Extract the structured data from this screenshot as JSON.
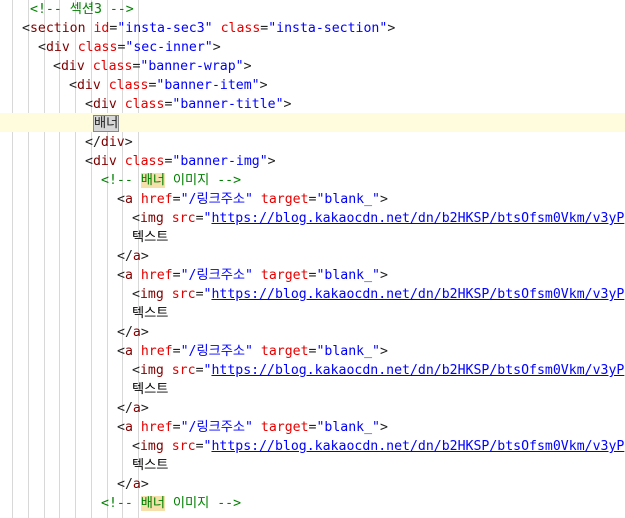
{
  "lines": [
    {
      "indent": 3,
      "parts": [
        {
          "t": "<!-- 섹션3 -->",
          "c": "comment"
        }
      ]
    },
    {
      "indent": 2,
      "parts": [
        {
          "t": "<",
          "c": "punct"
        },
        {
          "t": "section",
          "c": "tag"
        },
        {
          "t": " ",
          "c": "punct"
        },
        {
          "t": "id",
          "c": "attr"
        },
        {
          "t": "=",
          "c": "punct"
        },
        {
          "t": "\"insta-sec3\"",
          "c": "val"
        },
        {
          "t": " ",
          "c": "punct"
        },
        {
          "t": "class",
          "c": "attr"
        },
        {
          "t": "=",
          "c": "punct"
        },
        {
          "t": "\"insta-section\"",
          "c": "val"
        },
        {
          "t": ">",
          "c": "punct"
        }
      ]
    },
    {
      "indent": 4,
      "parts": [
        {
          "t": "<",
          "c": "punct"
        },
        {
          "t": "div",
          "c": "tag"
        },
        {
          "t": " ",
          "c": "punct"
        },
        {
          "t": "class",
          "c": "attr"
        },
        {
          "t": "=",
          "c": "punct"
        },
        {
          "t": "\"sec-inner\"",
          "c": "val"
        },
        {
          "t": ">",
          "c": "punct"
        }
      ]
    },
    {
      "indent": 6,
      "parts": [
        {
          "t": "<",
          "c": "punct"
        },
        {
          "t": "div",
          "c": "tag"
        },
        {
          "t": " ",
          "c": "punct"
        },
        {
          "t": "class",
          "c": "attr"
        },
        {
          "t": "=",
          "c": "punct"
        },
        {
          "t": "\"banner-wrap\"",
          "c": "val"
        },
        {
          "t": ">",
          "c": "punct"
        }
      ]
    },
    {
      "indent": 8,
      "parts": [
        {
          "t": "<",
          "c": "punct"
        },
        {
          "t": "div",
          "c": "tag"
        },
        {
          "t": " ",
          "c": "punct"
        },
        {
          "t": "class",
          "c": "attr"
        },
        {
          "t": "=",
          "c": "punct"
        },
        {
          "t": "\"banner-item\"",
          "c": "val"
        },
        {
          "t": ">",
          "c": "punct"
        }
      ]
    },
    {
      "indent": 10,
      "parts": [
        {
          "t": "<",
          "c": "punct"
        },
        {
          "t": "div",
          "c": "tag"
        },
        {
          "t": " ",
          "c": "punct"
        },
        {
          "t": "class",
          "c": "attr"
        },
        {
          "t": "=",
          "c": "punct"
        },
        {
          "t": "\"banner-title\"",
          "c": "val"
        },
        {
          "t": ">",
          "c": "punct"
        }
      ]
    },
    {
      "indent": 11,
      "parts": [
        {
          "t": "배너",
          "c": "sel"
        }
      ]
    },
    {
      "indent": 10,
      "parts": [
        {
          "t": "</",
          "c": "punct"
        },
        {
          "t": "div",
          "c": "tag"
        },
        {
          "t": ">",
          "c": "punct"
        }
      ]
    },
    {
      "indent": 10,
      "parts": [
        {
          "t": "<",
          "c": "punct"
        },
        {
          "t": "div",
          "c": "tag"
        },
        {
          "t": " ",
          "c": "punct"
        },
        {
          "t": "class",
          "c": "attr"
        },
        {
          "t": "=",
          "c": "punct"
        },
        {
          "t": "\"banner-img\"",
          "c": "val"
        },
        {
          "t": ">",
          "c": "punct"
        }
      ]
    },
    {
      "indent": 12,
      "parts": [
        {
          "t": "<!-- ",
          "c": "comment"
        },
        {
          "t": "배너",
          "c": "comment hl"
        },
        {
          "t": " 이미지 -->",
          "c": "comment"
        }
      ]
    },
    {
      "indent": 14,
      "parts": [
        {
          "t": "<",
          "c": "punct"
        },
        {
          "t": "a",
          "c": "tag"
        },
        {
          "t": " ",
          "c": "punct"
        },
        {
          "t": "href",
          "c": "attr"
        },
        {
          "t": "=",
          "c": "punct"
        },
        {
          "t": "\"/링크주소\"",
          "c": "val"
        },
        {
          "t": " ",
          "c": "punct"
        },
        {
          "t": "target",
          "c": "attr"
        },
        {
          "t": "=",
          "c": "punct"
        },
        {
          "t": "\"blank_\"",
          "c": "val"
        },
        {
          "t": ">",
          "c": "punct"
        }
      ]
    },
    {
      "indent": 16,
      "parts": [
        {
          "t": "<",
          "c": "punct"
        },
        {
          "t": "img",
          "c": "tag"
        },
        {
          "t": " ",
          "c": "punct"
        },
        {
          "t": "src",
          "c": "attr"
        },
        {
          "t": "=",
          "c": "punct"
        },
        {
          "t": "\"",
          "c": "val"
        },
        {
          "t": "https://blog.kakaocdn.net/dn/b2HKSP/btsOfsm0Vkm/v3yP",
          "c": "url"
        }
      ]
    },
    {
      "indent": 16,
      "parts": [
        {
          "t": "텍스트",
          "c": "txt"
        }
      ]
    },
    {
      "indent": 14,
      "parts": [
        {
          "t": "</",
          "c": "punct"
        },
        {
          "t": "a",
          "c": "tag"
        },
        {
          "t": ">",
          "c": "punct"
        }
      ]
    },
    {
      "indent": 14,
      "parts": [
        {
          "t": "<",
          "c": "punct"
        },
        {
          "t": "a",
          "c": "tag"
        },
        {
          "t": " ",
          "c": "punct"
        },
        {
          "t": "href",
          "c": "attr"
        },
        {
          "t": "=",
          "c": "punct"
        },
        {
          "t": "\"/링크주소\"",
          "c": "val"
        },
        {
          "t": " ",
          "c": "punct"
        },
        {
          "t": "target",
          "c": "attr"
        },
        {
          "t": "=",
          "c": "punct"
        },
        {
          "t": "\"blank_\"",
          "c": "val"
        },
        {
          "t": ">",
          "c": "punct"
        }
      ]
    },
    {
      "indent": 16,
      "parts": [
        {
          "t": "<",
          "c": "punct"
        },
        {
          "t": "img",
          "c": "tag"
        },
        {
          "t": " ",
          "c": "punct"
        },
        {
          "t": "src",
          "c": "attr"
        },
        {
          "t": "=",
          "c": "punct"
        },
        {
          "t": "\"",
          "c": "val"
        },
        {
          "t": "https://blog.kakaocdn.net/dn/b2HKSP/btsOfsm0Vkm/v3yP",
          "c": "url"
        }
      ]
    },
    {
      "indent": 16,
      "parts": [
        {
          "t": "텍스트",
          "c": "txt"
        }
      ]
    },
    {
      "indent": 14,
      "parts": [
        {
          "t": "</",
          "c": "punct"
        },
        {
          "t": "a",
          "c": "tag"
        },
        {
          "t": ">",
          "c": "punct"
        }
      ]
    },
    {
      "indent": 14,
      "parts": [
        {
          "t": "<",
          "c": "punct"
        },
        {
          "t": "a",
          "c": "tag"
        },
        {
          "t": " ",
          "c": "punct"
        },
        {
          "t": "href",
          "c": "attr"
        },
        {
          "t": "=",
          "c": "punct"
        },
        {
          "t": "\"/링크주소\"",
          "c": "val"
        },
        {
          "t": " ",
          "c": "punct"
        },
        {
          "t": "target",
          "c": "attr"
        },
        {
          "t": "=",
          "c": "punct"
        },
        {
          "t": "\"blank_\"",
          "c": "val"
        },
        {
          "t": ">",
          "c": "punct"
        }
      ]
    },
    {
      "indent": 16,
      "parts": [
        {
          "t": "<",
          "c": "punct"
        },
        {
          "t": "img",
          "c": "tag"
        },
        {
          "t": " ",
          "c": "punct"
        },
        {
          "t": "src",
          "c": "attr"
        },
        {
          "t": "=",
          "c": "punct"
        },
        {
          "t": "\"",
          "c": "val"
        },
        {
          "t": "https://blog.kakaocdn.net/dn/b2HKSP/btsOfsm0Vkm/v3yP",
          "c": "url"
        }
      ]
    },
    {
      "indent": 16,
      "parts": [
        {
          "t": "텍스트",
          "c": "txt"
        }
      ]
    },
    {
      "indent": 14,
      "parts": [
        {
          "t": "</",
          "c": "punct"
        },
        {
          "t": "a",
          "c": "tag"
        },
        {
          "t": ">",
          "c": "punct"
        }
      ]
    },
    {
      "indent": 14,
      "parts": [
        {
          "t": "<",
          "c": "punct"
        },
        {
          "t": "a",
          "c": "tag"
        },
        {
          "t": " ",
          "c": "punct"
        },
        {
          "t": "href",
          "c": "attr"
        },
        {
          "t": "=",
          "c": "punct"
        },
        {
          "t": "\"/링크주소\"",
          "c": "val"
        },
        {
          "t": " ",
          "c": "punct"
        },
        {
          "t": "target",
          "c": "attr"
        },
        {
          "t": "=",
          "c": "punct"
        },
        {
          "t": "\"blank_\"",
          "c": "val"
        },
        {
          "t": ">",
          "c": "punct"
        }
      ]
    },
    {
      "indent": 16,
      "parts": [
        {
          "t": "<",
          "c": "punct"
        },
        {
          "t": "img",
          "c": "tag"
        },
        {
          "t": " ",
          "c": "punct"
        },
        {
          "t": "src",
          "c": "attr"
        },
        {
          "t": "=",
          "c": "punct"
        },
        {
          "t": "\"",
          "c": "val"
        },
        {
          "t": "https://blog.kakaocdn.net/dn/b2HKSP/btsOfsm0Vkm/v3yP",
          "c": "url"
        }
      ]
    },
    {
      "indent": 16,
      "parts": [
        {
          "t": "텍스트",
          "c": "txt"
        }
      ]
    },
    {
      "indent": 14,
      "parts": [
        {
          "t": "</",
          "c": "punct"
        },
        {
          "t": "a",
          "c": "tag"
        },
        {
          "t": ">",
          "c": "punct"
        }
      ]
    },
    {
      "indent": 12,
      "parts": [
        {
          "t": "<!-- ",
          "c": "comment"
        },
        {
          "t": "배너",
          "c": "comment hl"
        },
        {
          "t": " 이미지 -->",
          "c": "comment"
        }
      ]
    }
  ],
  "colors": {
    "tag": "#800000",
    "attribute": "#e50000",
    "value": "#0000ff",
    "comment": "#008000",
    "current_line": "#fffbdd",
    "word_highlight": "#f5dfaa"
  }
}
